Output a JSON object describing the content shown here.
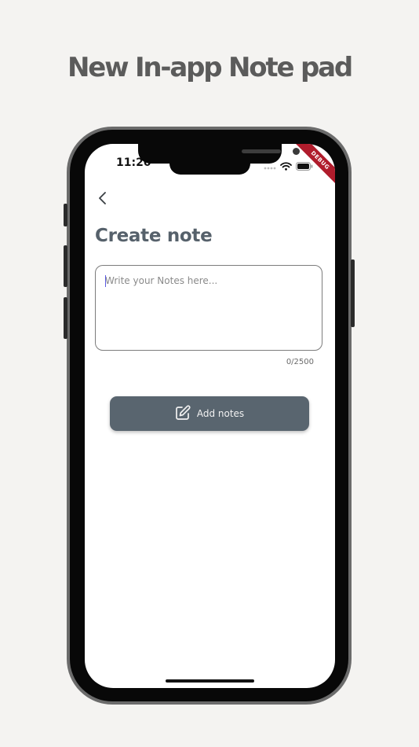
{
  "marketing": {
    "headline": "New In-app Note pad"
  },
  "status_bar": {
    "time": "11:20",
    "debug_banner": "DEBUG"
  },
  "screen": {
    "title": "Create note",
    "note_input": {
      "placeholder": "Write your Notes here...",
      "value": ""
    },
    "char_counter": "0/2500",
    "add_button": {
      "label": "Add notes",
      "icon": "edit-note-icon"
    },
    "back_icon": "chevron-left-icon"
  },
  "colors": {
    "background": "#f4f3f1",
    "headline": "#5b5b5b",
    "title": "#56616b",
    "button": "#59656f",
    "debug_ribbon": "#b01c2c"
  }
}
